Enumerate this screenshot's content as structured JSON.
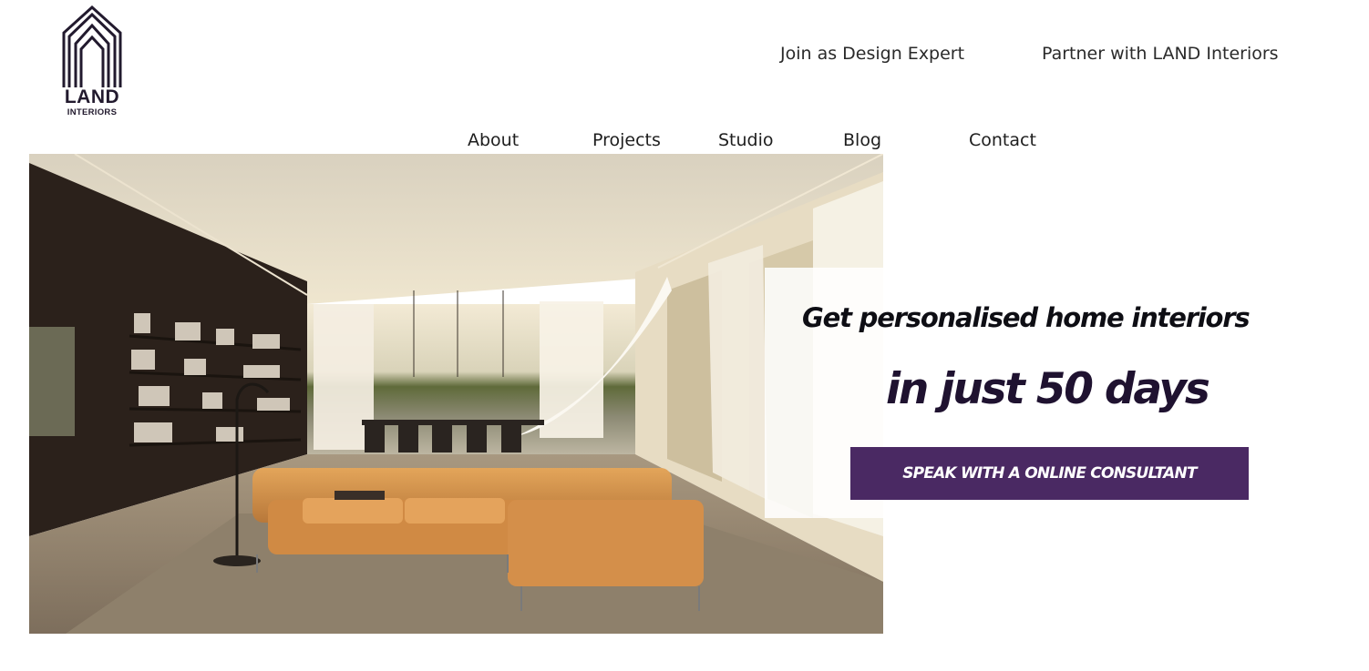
{
  "brand": {
    "name": "LAND",
    "sub": "INTERIORS"
  },
  "header": {
    "top_links": [
      "Join as Design Expert",
      "Partner with LAND Interiors"
    ],
    "nav": [
      "About",
      "Projects",
      "Studio",
      "Blog",
      "Contact"
    ]
  },
  "hero": {
    "image": "modern-living-room-photo",
    "headline": "Get personalised home interiors",
    "subheadline": "in just 50 days",
    "cta_label": "SPEAK WITH A ONLINE CONSULTANT"
  },
  "colors": {
    "accent": "#4a2963",
    "headline_dark": "#1f1230",
    "sofa": "#d9954a",
    "dark_wall": "#2a201b"
  }
}
